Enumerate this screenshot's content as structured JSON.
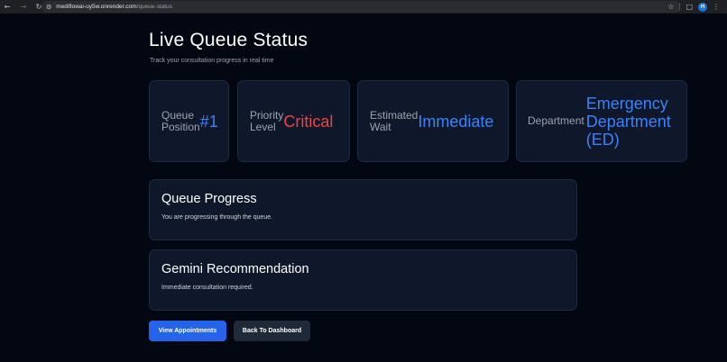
{
  "browser": {
    "url_host": "mediflowai-uy5w.onrender.com",
    "url_path": "/queue-status",
    "profile_initial": "H"
  },
  "page": {
    "title": "Live Queue Status",
    "subtitle": "Track your consultation progress in real time"
  },
  "stats": {
    "queue": {
      "label_line1": "Queue",
      "label_line2": "Position",
      "value": "#1"
    },
    "priority": {
      "label_line1": "Priority",
      "label_line2": "Level",
      "value": "Critical"
    },
    "wait": {
      "label_line1": "Estimated",
      "label_line2": "Wait",
      "value": "Immediate"
    },
    "department": {
      "label": "Department",
      "value": "Emergency Department (ED)"
    }
  },
  "progress": {
    "title": "Queue Progress",
    "text": "You are progressing through the queue."
  },
  "gemini": {
    "title": "Gemini Recommendation",
    "text": "Immediate consultation required."
  },
  "buttons": {
    "appointments": "View Appointments",
    "dashboard": "Back To Dashboard"
  },
  "colors": {
    "accent_blue": "#3b82f6",
    "critical_red": "#ef4444",
    "primary_button": "#2563eb",
    "background": "#030712"
  }
}
